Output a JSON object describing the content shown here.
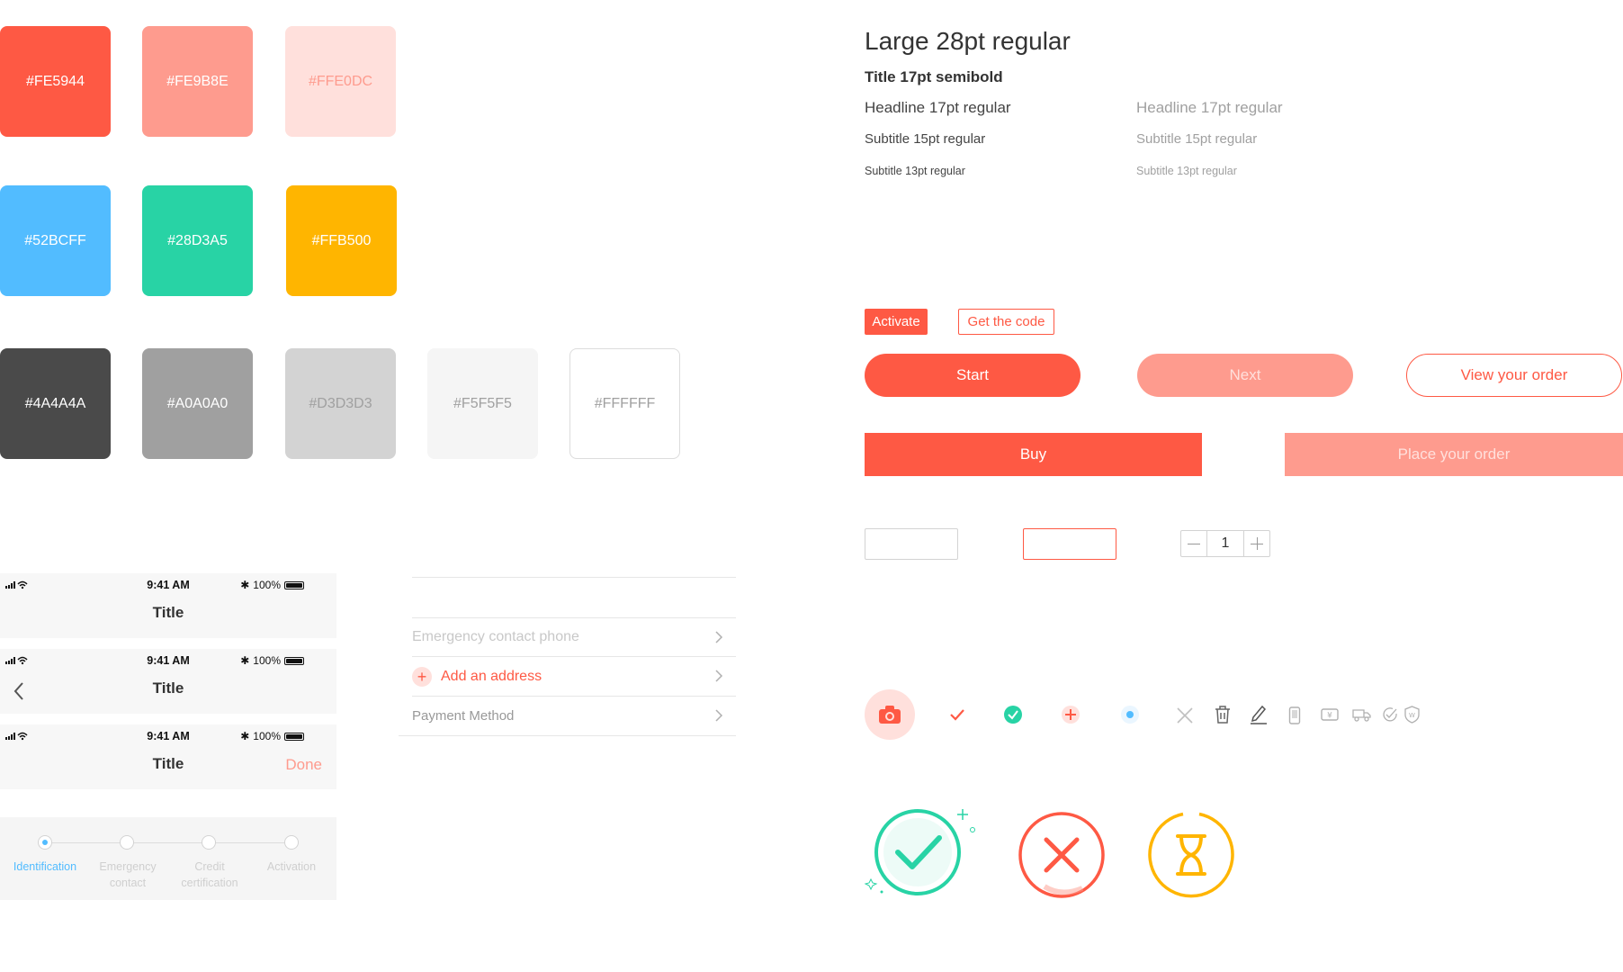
{
  "palette": {
    "row1": [
      {
        "label": "#FE5944",
        "color": "#FE5944",
        "text_color": "#FFFFFF"
      },
      {
        "label": "#FE9B8E",
        "color": "#FE9B8E",
        "text_color": "#FFFFFF"
      },
      {
        "label": "#FFE0DC",
        "color": "#FFE0DC",
        "text_color": "#FE9B8E"
      }
    ],
    "row2": [
      {
        "label": "#52BCFF",
        "color": "#52BCFF",
        "text_color": "#FFFFFF"
      },
      {
        "label": "#28D3A5",
        "color": "#28D3A5",
        "text_color": "#FFFFFF"
      },
      {
        "label": "#FFB500",
        "color": "#FFB500",
        "text_color": "#FFFFFF"
      }
    ],
    "row3": [
      {
        "label": "#4A4A4A",
        "color": "#4A4A4A",
        "text_color": "#FFFFFF"
      },
      {
        "label": "#A0A0A0",
        "color": "#A0A0A0",
        "text_color": "#FFFFFF"
      },
      {
        "label": "#D3D3D3",
        "color": "#D3D3D3",
        "text_color": "#A0A0A0"
      },
      {
        "label": "#F5F5F5",
        "color": "#F5F5F5",
        "text_color": "#A0A0A0"
      },
      {
        "label": "#FFFFFF",
        "color": "#FFFFFF",
        "text_color": "#A0A0A0"
      }
    ]
  },
  "typography": {
    "large": "Large 28pt regular",
    "title": "Title 17pt semibold",
    "headline": "Headline 17pt regular",
    "headline_light": "Headline 17pt regular",
    "subtitle15": "Subtitle 15pt regular",
    "subtitle15_light": "Subtitle 15pt regular",
    "subtitle13": "Subtitle 13pt regular",
    "subtitle13_light": "Subtitle 13pt regular"
  },
  "buttons": {
    "activate": "Activate",
    "get_code": "Get the code",
    "start": "Start",
    "next": "Next",
    "view_order": "View your order",
    "buy": "Buy",
    "place_order": "Place your order"
  },
  "stepper": {
    "value": "1"
  },
  "status_bar": {
    "time": "9:41 AM",
    "battery": "100%"
  },
  "navbars": [
    {
      "title": "Title"
    },
    {
      "title": "Title"
    },
    {
      "title": "Title",
      "right": "Done"
    }
  ],
  "list": {
    "emergency_phone": "Emergency contact phone",
    "add_address": "Add an address",
    "payment_method": "Payment Method"
  },
  "steps": [
    {
      "label": "Identification",
      "active": true
    },
    {
      "label": "Emergency contact",
      "active": false
    },
    {
      "label": "Credit certification",
      "active": false
    },
    {
      "label": "Activation",
      "active": false
    }
  ],
  "icons": [
    "camera-icon",
    "check-icon",
    "check-circle-icon",
    "plus-circle-icon",
    "radio-dot-icon",
    "close-icon",
    "trash-icon",
    "edit-pen-icon",
    "phone-icon",
    "cash-icon",
    "truck-icon",
    "done-circle-icon",
    "shield-icon"
  ],
  "colors": {
    "primary": "#FE5944",
    "primary_light": "#FE9B8E",
    "primary_pale": "#FFE0DC",
    "blue": "#52BCFF",
    "green": "#28D3A5",
    "yellow": "#FFB500"
  }
}
